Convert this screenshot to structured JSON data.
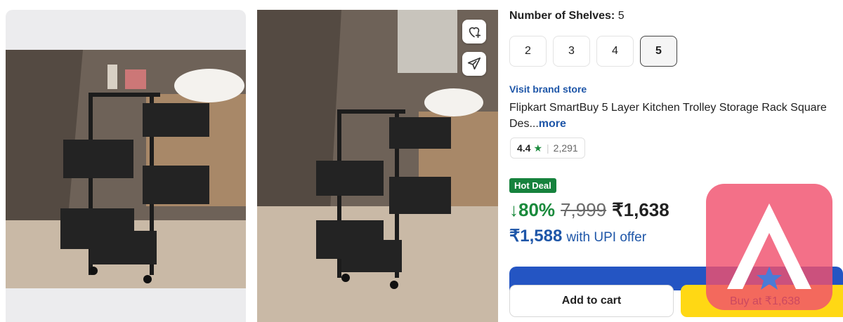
{
  "gallery": {
    "image1": {
      "alt": "",
      "icon": "product-photo"
    },
    "image2": {
      "alt": "",
      "icon": "product-photo"
    },
    "wishlist_icon": "heart-plus-icon",
    "share_icon": "send-icon"
  },
  "shelves": {
    "label": "Number of Shelves:",
    "selected": "5",
    "options": [
      "2",
      "3",
      "4",
      "5"
    ]
  },
  "product": {
    "brand_link": "Visit brand store",
    "title": "Flipkart SmartBuy 5 Layer Kitchen Trolley Storage Rack Square Des...",
    "more_label": "more",
    "rating": "4.4",
    "rating_star": "★",
    "rating_count": "2,291"
  },
  "pricing": {
    "badge": "Hot Deal",
    "discount": "↓80%",
    "mrp": "7,999",
    "price": "₹1,638",
    "upi_price": "₹1,588",
    "upi_text": "with UPI offer"
  },
  "actions": {
    "add_to_cart": "Add to cart",
    "buy_now": "Buy at ₹1,638"
  },
  "colors": {
    "accent_blue": "#1e56a8",
    "deal_green": "#16823d",
    "buy_yellow": "#ffd814",
    "bar_blue": "#2455c3"
  }
}
